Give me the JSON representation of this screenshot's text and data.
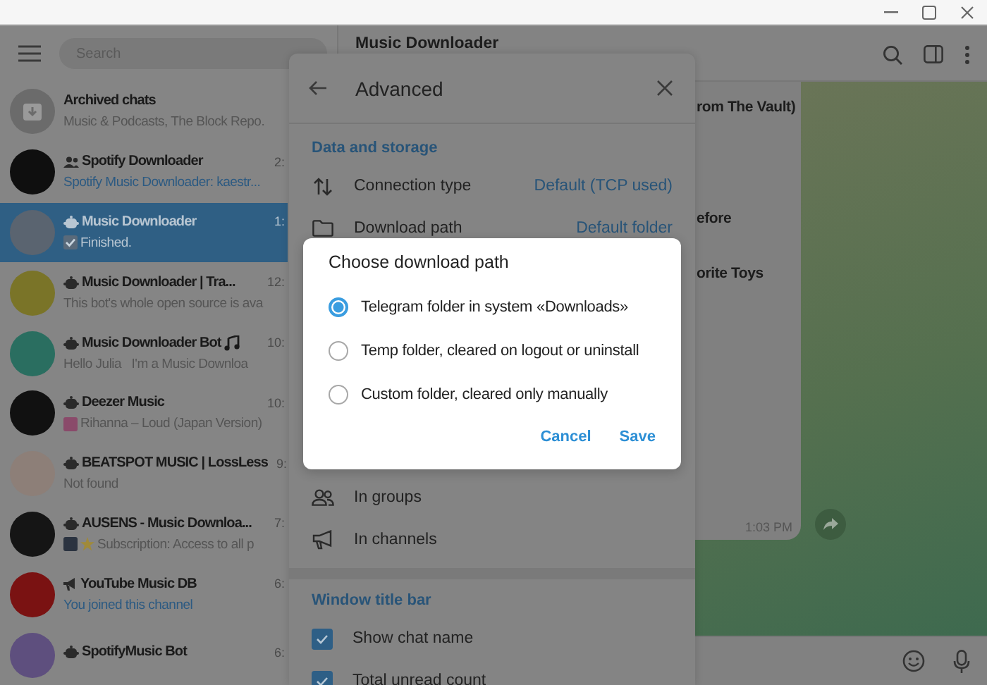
{
  "search": {
    "placeholder": "Search"
  },
  "chats": [
    {
      "kind": "archive",
      "name": "Archived chats",
      "preview": "Music & Podcasts, The Block Repo.",
      "color": "#6b6b6b",
      "selected": false,
      "preview_highlighted": false
    },
    {
      "kind": "group",
      "name": "Spotify Downloader",
      "time": "2:",
      "preview": "Spotify Music Downloader: kaestr...",
      "color": "#0f0f0f",
      "selected": false,
      "preview_highlighted": true
    },
    {
      "kind": "bot",
      "name": "Music Downloader",
      "time": "1:",
      "preview": "Finished.",
      "preview_icons": [
        {
          "kind": "check"
        }
      ],
      "color": "#5a6470",
      "selected": true,
      "preview_highlighted": false
    },
    {
      "kind": "bot",
      "name": "Music Downloader | Tra...",
      "time": "12:",
      "preview": "This bot's whole open source is ava",
      "color": "#7a7428",
      "selected": false,
      "preview_highlighted": false
    },
    {
      "kind": "bot",
      "name": "Music Downloader Bot",
      "name_icons": [
        {
          "kind": "note"
        }
      ],
      "time": "10:",
      "preview": "Hello Julia   I'm a Music Downloa",
      "color": "#2a6e60",
      "selected": false,
      "preview_highlighted": false
    },
    {
      "kind": "bot",
      "name": "Deezer Music",
      "time": "10:",
      "preview": "Rihanna – Loud (Japan Version)",
      "preview_icons": [
        {
          "kind": "thumbnail"
        }
      ],
      "color": "#111111",
      "selected": false,
      "preview_highlighted": false
    },
    {
      "kind": "bot",
      "name": "BEATSPOT MUSIC | LossLess",
      "time": "9:",
      "preview": "Not found",
      "color": "#8d7f78",
      "selected": false,
      "preview_highlighted": false
    },
    {
      "kind": "bot",
      "name": "AUSENS - Music Downloa...",
      "time": "7:",
      "preview": "Subscription: Access to all p",
      "preview_icons": [
        {
          "kind": "thumbnail"
        },
        {
          "kind": "star"
        }
      ],
      "color": "#151515",
      "selected": false,
      "preview_highlighted": false
    },
    {
      "kind": "channel",
      "name": "YouTube Music DB",
      "time": "6:",
      "preview": "You joined this channel",
      "color": "#7a1212",
      "selected": false,
      "preview_highlighted": true
    },
    {
      "kind": "bot",
      "name": "SpotifyMusic Bot",
      "time": "6:",
      "color": "#5e4f7e",
      "selected": false
    }
  ],
  "chat": {
    "title": "Music Downloader",
    "message_lines": [
      "rom The Vault)",
      "efore",
      "orite Toys"
    ],
    "message_time": "1:03 PM"
  },
  "panel": {
    "title": "Advanced",
    "sections": [
      {
        "title": "Data and storage",
        "rows": [
          {
            "kind": "value",
            "label": "Connection type",
            "value": "Default (TCP used)"
          },
          {
            "kind": "value",
            "label": "Download path",
            "value": "Default folder"
          }
        ]
      },
      {
        "rows": [
          {
            "kind": "plain",
            "label": "In groups"
          },
          {
            "kind": "plain",
            "label": "In channels"
          }
        ]
      },
      {
        "title": "Window title bar",
        "rows": [
          {
            "kind": "checkbox",
            "label": "Show chat name",
            "checked": true
          },
          {
            "kind": "checkbox",
            "label": "Total unread count",
            "checked": true
          }
        ]
      }
    ]
  },
  "dialog": {
    "title": "Choose download path",
    "options": [
      {
        "label": "Telegram folder in system «Downloads»",
        "selected": true
      },
      {
        "label": "Temp folder, cleared on logout or uninstall",
        "selected": false
      },
      {
        "label": "Custom folder, cleared only manually",
        "selected": false
      }
    ],
    "buttons": [
      "Cancel",
      "Save"
    ]
  }
}
